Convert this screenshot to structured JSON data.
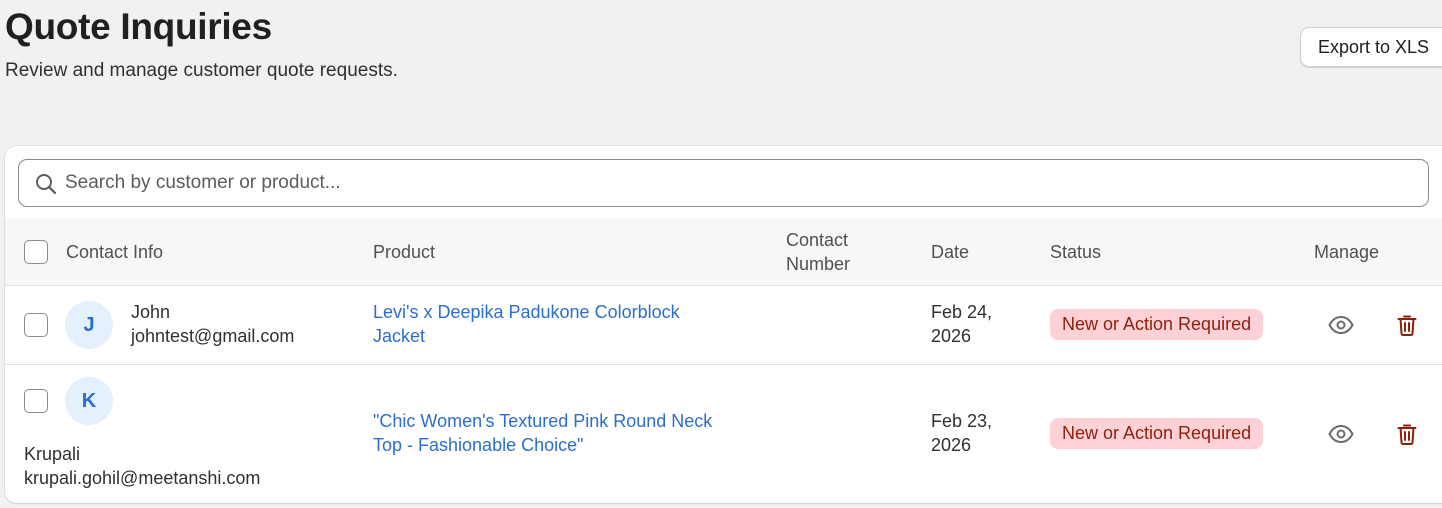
{
  "header": {
    "title": "Quote Inquiries",
    "subtitle": "Review and manage customer quote requests.",
    "export_label": "Export to XLS"
  },
  "search": {
    "placeholder": "Search by customer or product...",
    "value": ""
  },
  "table": {
    "columns": {
      "contact_info": "Contact Info",
      "product": "Product",
      "contact_number_line1": "Contact",
      "contact_number_line2": "Number",
      "date": "Date",
      "status": "Status",
      "manage": "Manage"
    },
    "rows": [
      {
        "initial": "J",
        "name": "John",
        "email": "johntest@gmail.com",
        "product_line1": "Levi's x Deepika Padukone Colorblock",
        "product_line2": "Jacket",
        "contact_number": "",
        "date_line1": "Feb 24,",
        "date_line2": "2026",
        "status": "New or Action Required"
      },
      {
        "initial": "K",
        "name": "Krupali",
        "email": "krupali.gohil@meetanshi.com",
        "product_line1": "\"Chic Women's Textured Pink Round Neck",
        "product_line2": "Top - Fashionable Choice\"",
        "contact_number": "",
        "date_line1": "Feb 23,",
        "date_line2": "2026",
        "status": "New or Action Required"
      }
    ]
  },
  "icons": {
    "search": "search-icon",
    "view": "eye-icon",
    "delete": "trash-icon"
  },
  "colors": {
    "link": "#2c6ecb",
    "badge_bg": "#fed1d7",
    "badge_text": "#8e1f0b",
    "delete_icon": "#8e1f0b",
    "avatar_bg": "#e4f0fb"
  }
}
